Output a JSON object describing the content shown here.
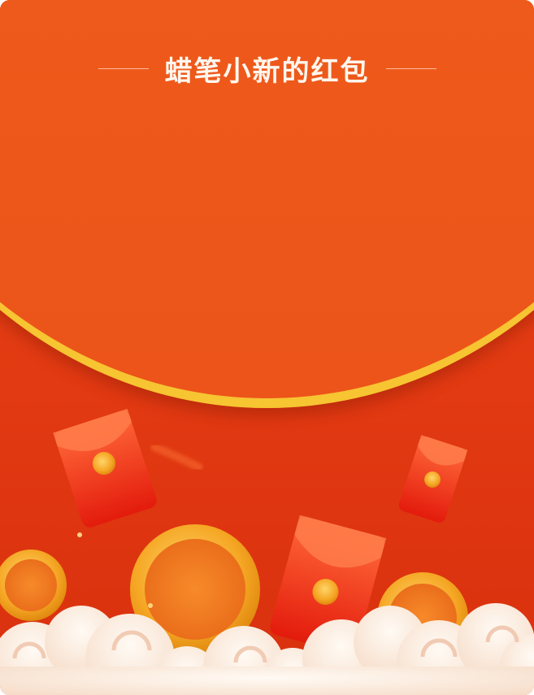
{
  "envelope": {
    "title": "蜡笔小新的红包",
    "colors": {
      "background": "#e23a12",
      "flap": "#ef5a1b",
      "flap_border": "#f7c432",
      "title_text": "#fff6ee"
    }
  },
  "decoration": {
    "icons": [
      "red-envelope-icon",
      "gold-coin-icon",
      "cloud-icon"
    ]
  }
}
